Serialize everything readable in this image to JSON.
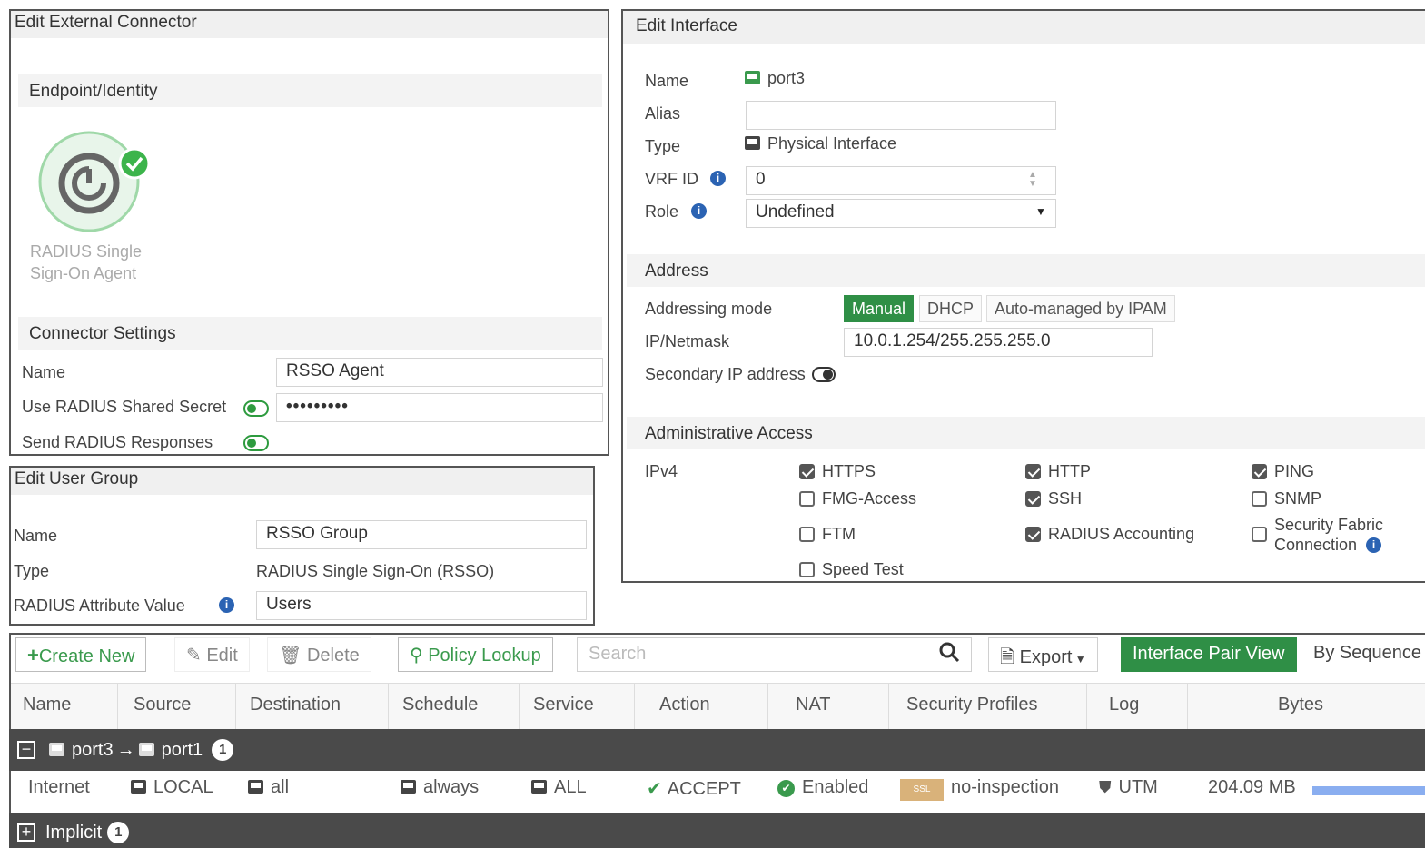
{
  "connector": {
    "title": "Edit External Connector",
    "endpoint_section": "Endpoint/Identity",
    "agent_label_line1": "RADIUS Single",
    "agent_label_line2": "Sign-On Agent",
    "settings_section": "Connector Settings",
    "name_label": "Name",
    "name_value": "RSSO Agent",
    "secret_label": "Use RADIUS Shared Secret",
    "secret_value": "•••••••••",
    "responses_label": "Send RADIUS Responses"
  },
  "user_group": {
    "title": "Edit User Group",
    "name_label": "Name",
    "name_value": "RSSO Group",
    "type_label": "Type",
    "type_value": "RADIUS Single Sign-On (RSSO)",
    "attr_label": "RADIUS Attribute Value",
    "attr_value": "Users"
  },
  "interface": {
    "title": "Edit Interface",
    "name_label": "Name",
    "name_value": "port3",
    "alias_label": "Alias",
    "alias_value": "",
    "type_label": "Type",
    "type_value": "Physical Interface",
    "vrf_label": "VRF ID",
    "vrf_value": "0",
    "role_label": "Role",
    "role_value": "Undefined",
    "address_section": "Address",
    "addressing_mode_label": "Addressing mode",
    "modes": [
      "Manual",
      "DHCP",
      "Auto-managed by IPAM"
    ],
    "ip_label": "IP/Netmask",
    "ip_value": "10.0.1.254/255.255.255.0",
    "secondary_label": "Secondary IP address",
    "admin_section": "Administrative Access",
    "ipv4_label": "IPv4",
    "access": {
      "https": "HTTPS",
      "http": "HTTP",
      "ping": "PING",
      "fmg": "FMG-Access",
      "ssh": "SSH",
      "snmp": "SNMP",
      "ftm": "FTM",
      "radius_acct": "RADIUS Accounting",
      "fabric_line1": "Security Fabric",
      "fabric_line2": "Connection",
      "speed": "Speed Test"
    }
  },
  "toolbar": {
    "create": "Create New",
    "edit": "Edit",
    "delete": "Delete",
    "policy_lookup": "Policy Lookup",
    "search_placeholder": "Search",
    "export": "Export",
    "interface_pair": "Interface Pair View",
    "by_sequence": "By Sequence"
  },
  "table": {
    "headers": [
      "Name",
      "Source",
      "Destination",
      "Schedule",
      "Service",
      "Action",
      "NAT",
      "Security Profiles",
      "Log",
      "Bytes"
    ],
    "group1": {
      "from": "port3",
      "arrow": "→",
      "to": "port1",
      "count": "1"
    },
    "row": {
      "name": "Internet",
      "source": "LOCAL",
      "destination": "all",
      "schedule": "always",
      "service": "ALL",
      "action": "ACCEPT",
      "nat": "Enabled",
      "ssl_badge": "SSL",
      "profile": "no-inspection",
      "log": "UTM",
      "bytes": "204.09 MB"
    },
    "group2": {
      "name": "Implicit",
      "count": "1"
    }
  },
  "colors": {
    "accent_green": "#2f8f46",
    "info_blue": "#2b63b3",
    "group_row": "#4a4a4a",
    "bytes_bar": "#8aaef0"
  }
}
